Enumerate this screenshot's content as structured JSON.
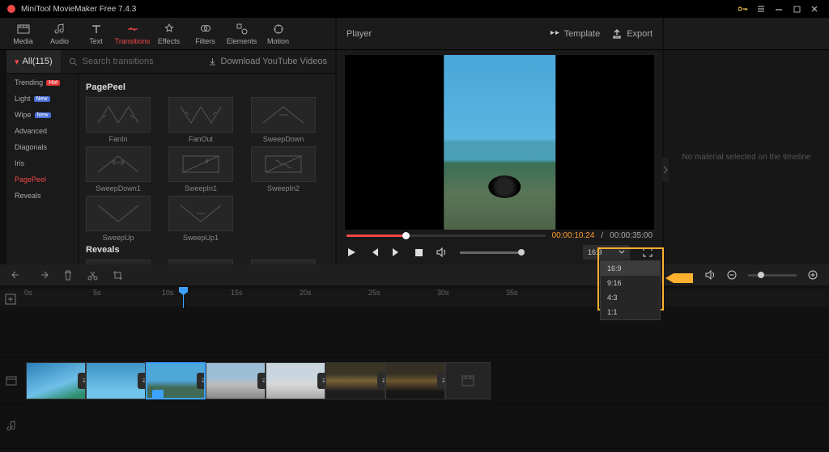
{
  "app": {
    "title": "MiniTool MovieMaker Free 7.4.3"
  },
  "tabs": [
    {
      "id": "media",
      "label": "Media"
    },
    {
      "id": "audio",
      "label": "Audio"
    },
    {
      "id": "text",
      "label": "Text"
    },
    {
      "id": "transitions",
      "label": "Transitions"
    },
    {
      "id": "effects",
      "label": "Effects"
    },
    {
      "id": "filters",
      "label": "Filters"
    },
    {
      "id": "elements",
      "label": "Elements"
    },
    {
      "id": "motion",
      "label": "Motion"
    }
  ],
  "active_tab": "transitions",
  "player_header": {
    "title": "Player",
    "template": "Template",
    "export": "Export"
  },
  "filter": {
    "all": "All(115)",
    "search_placeholder": "Search transitions",
    "download": "Download YouTube Videos"
  },
  "categories": [
    {
      "label": "Trending",
      "badge": "Hot",
      "badge_cls": "hot"
    },
    {
      "label": "Light",
      "badge": "New",
      "badge_cls": "new"
    },
    {
      "label": "Wipe",
      "badge": "New",
      "badge_cls": "new"
    },
    {
      "label": "Advanced"
    },
    {
      "label": "Diagonals"
    },
    {
      "label": "Iris"
    },
    {
      "label": "PagePeel",
      "selected": true
    },
    {
      "label": "Reveals"
    }
  ],
  "sections": [
    {
      "title": "PagePeel",
      "items": [
        "FanIn",
        "FanOut",
        "SweepDown",
        "SweepDown1",
        "SweepIn1",
        "SweepIn2",
        "SweepUp",
        "SweepUp1"
      ]
    },
    {
      "title": "Reveals",
      "items": [
        "",
        "",
        ""
      ]
    }
  ],
  "player": {
    "current": "00:00:10:24",
    "total": "00:00:35:00",
    "aspect_selected": "16:9",
    "aspect_options": [
      "16:9",
      "9:16",
      "4:3",
      "1:1"
    ]
  },
  "props": {
    "empty_msg": "No material selected on the timeline"
  },
  "ruler": [
    "0s",
    "5s",
    "10s",
    "15s",
    "20s",
    "25s",
    "30s",
    "35s"
  ]
}
